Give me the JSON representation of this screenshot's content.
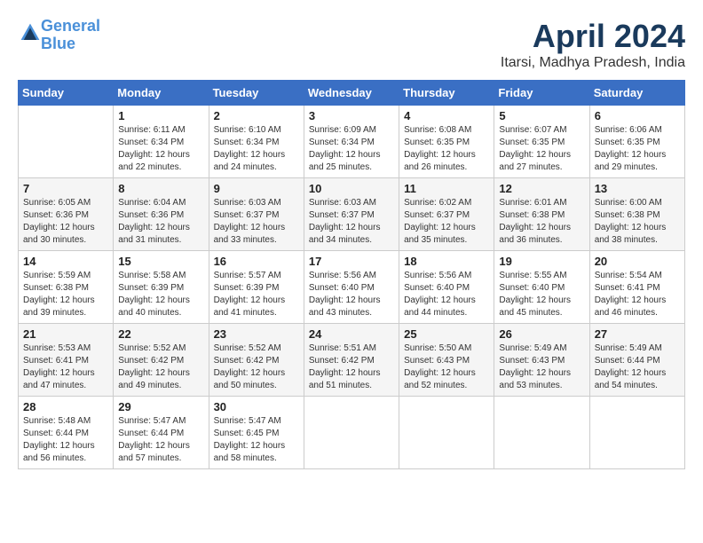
{
  "header": {
    "logo_line1": "General",
    "logo_line2": "Blue",
    "month_year": "April 2024",
    "location": "Itarsi, Madhya Pradesh, India"
  },
  "columns": [
    "Sunday",
    "Monday",
    "Tuesday",
    "Wednesday",
    "Thursday",
    "Friday",
    "Saturday"
  ],
  "weeks": [
    [
      {
        "day": "",
        "info": ""
      },
      {
        "day": "1",
        "info": "Sunrise: 6:11 AM\nSunset: 6:34 PM\nDaylight: 12 hours\nand 22 minutes."
      },
      {
        "day": "2",
        "info": "Sunrise: 6:10 AM\nSunset: 6:34 PM\nDaylight: 12 hours\nand 24 minutes."
      },
      {
        "day": "3",
        "info": "Sunrise: 6:09 AM\nSunset: 6:34 PM\nDaylight: 12 hours\nand 25 minutes."
      },
      {
        "day": "4",
        "info": "Sunrise: 6:08 AM\nSunset: 6:35 PM\nDaylight: 12 hours\nand 26 minutes."
      },
      {
        "day": "5",
        "info": "Sunrise: 6:07 AM\nSunset: 6:35 PM\nDaylight: 12 hours\nand 27 minutes."
      },
      {
        "day": "6",
        "info": "Sunrise: 6:06 AM\nSunset: 6:35 PM\nDaylight: 12 hours\nand 29 minutes."
      }
    ],
    [
      {
        "day": "7",
        "info": "Sunrise: 6:05 AM\nSunset: 6:36 PM\nDaylight: 12 hours\nand 30 minutes."
      },
      {
        "day": "8",
        "info": "Sunrise: 6:04 AM\nSunset: 6:36 PM\nDaylight: 12 hours\nand 31 minutes."
      },
      {
        "day": "9",
        "info": "Sunrise: 6:03 AM\nSunset: 6:37 PM\nDaylight: 12 hours\nand 33 minutes."
      },
      {
        "day": "10",
        "info": "Sunrise: 6:03 AM\nSunset: 6:37 PM\nDaylight: 12 hours\nand 34 minutes."
      },
      {
        "day": "11",
        "info": "Sunrise: 6:02 AM\nSunset: 6:37 PM\nDaylight: 12 hours\nand 35 minutes."
      },
      {
        "day": "12",
        "info": "Sunrise: 6:01 AM\nSunset: 6:38 PM\nDaylight: 12 hours\nand 36 minutes."
      },
      {
        "day": "13",
        "info": "Sunrise: 6:00 AM\nSunset: 6:38 PM\nDaylight: 12 hours\nand 38 minutes."
      }
    ],
    [
      {
        "day": "14",
        "info": "Sunrise: 5:59 AM\nSunset: 6:38 PM\nDaylight: 12 hours\nand 39 minutes."
      },
      {
        "day": "15",
        "info": "Sunrise: 5:58 AM\nSunset: 6:39 PM\nDaylight: 12 hours\nand 40 minutes."
      },
      {
        "day": "16",
        "info": "Sunrise: 5:57 AM\nSunset: 6:39 PM\nDaylight: 12 hours\nand 41 minutes."
      },
      {
        "day": "17",
        "info": "Sunrise: 5:56 AM\nSunset: 6:40 PM\nDaylight: 12 hours\nand 43 minutes."
      },
      {
        "day": "18",
        "info": "Sunrise: 5:56 AM\nSunset: 6:40 PM\nDaylight: 12 hours\nand 44 minutes."
      },
      {
        "day": "19",
        "info": "Sunrise: 5:55 AM\nSunset: 6:40 PM\nDaylight: 12 hours\nand 45 minutes."
      },
      {
        "day": "20",
        "info": "Sunrise: 5:54 AM\nSunset: 6:41 PM\nDaylight: 12 hours\nand 46 minutes."
      }
    ],
    [
      {
        "day": "21",
        "info": "Sunrise: 5:53 AM\nSunset: 6:41 PM\nDaylight: 12 hours\nand 47 minutes."
      },
      {
        "day": "22",
        "info": "Sunrise: 5:52 AM\nSunset: 6:42 PM\nDaylight: 12 hours\nand 49 minutes."
      },
      {
        "day": "23",
        "info": "Sunrise: 5:52 AM\nSunset: 6:42 PM\nDaylight: 12 hours\nand 50 minutes."
      },
      {
        "day": "24",
        "info": "Sunrise: 5:51 AM\nSunset: 6:42 PM\nDaylight: 12 hours\nand 51 minutes."
      },
      {
        "day": "25",
        "info": "Sunrise: 5:50 AM\nSunset: 6:43 PM\nDaylight: 12 hours\nand 52 minutes."
      },
      {
        "day": "26",
        "info": "Sunrise: 5:49 AM\nSunset: 6:43 PM\nDaylight: 12 hours\nand 53 minutes."
      },
      {
        "day": "27",
        "info": "Sunrise: 5:49 AM\nSunset: 6:44 PM\nDaylight: 12 hours\nand 54 minutes."
      }
    ],
    [
      {
        "day": "28",
        "info": "Sunrise: 5:48 AM\nSunset: 6:44 PM\nDaylight: 12 hours\nand 56 minutes."
      },
      {
        "day": "29",
        "info": "Sunrise: 5:47 AM\nSunset: 6:44 PM\nDaylight: 12 hours\nand 57 minutes."
      },
      {
        "day": "30",
        "info": "Sunrise: 5:47 AM\nSunset: 6:45 PM\nDaylight: 12 hours\nand 58 minutes."
      },
      {
        "day": "",
        "info": ""
      },
      {
        "day": "",
        "info": ""
      },
      {
        "day": "",
        "info": ""
      },
      {
        "day": "",
        "info": ""
      }
    ]
  ]
}
